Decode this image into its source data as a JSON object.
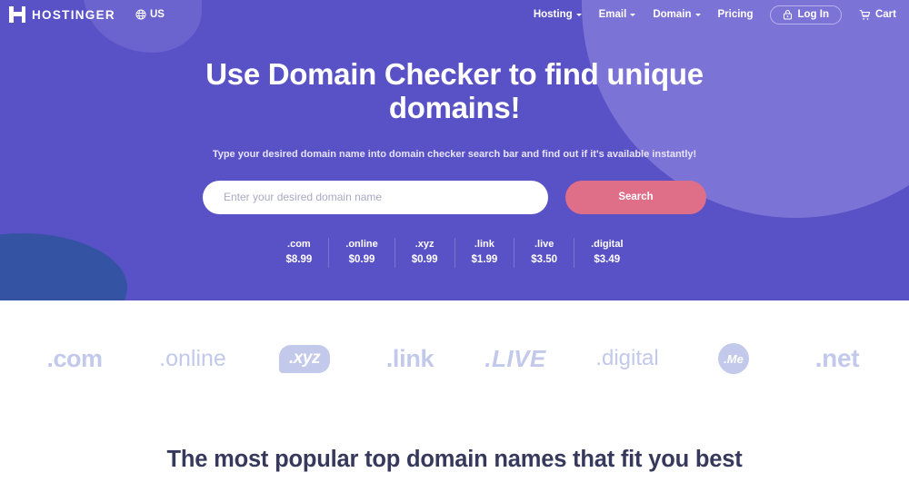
{
  "header": {
    "brand_name": "HOSTINGER",
    "logo_icon": "hostinger-h-logo-icon",
    "locale": {
      "icon": "globe-icon",
      "label": "US"
    },
    "nav": [
      {
        "label": "Hosting",
        "has_caret": true
      },
      {
        "label": "Email",
        "has_caret": true
      },
      {
        "label": "Domain",
        "has_caret": true
      },
      {
        "label": "Pricing",
        "has_caret": false
      }
    ],
    "login": {
      "label": "Log In",
      "icon": "lock-icon"
    },
    "cart": {
      "label": "Cart",
      "icon": "shopping-cart-icon"
    }
  },
  "hero": {
    "title": "Use Domain Checker to find unique domains!",
    "subtitle": "Type your desired domain name into domain checker search bar and find out if it's available instantly!",
    "search": {
      "placeholder": "Enter your desired domain name",
      "value": "",
      "button_label": "Search"
    },
    "prices": [
      {
        "tld": ".com",
        "price": "$8.99"
      },
      {
        "tld": ".online",
        "price": "$0.99"
      },
      {
        "tld": ".xyz",
        "price": "$0.99"
      },
      {
        "tld": ".link",
        "price": "$1.99"
      },
      {
        "tld": ".live",
        "price": "$3.50"
      },
      {
        "tld": ".digital",
        "price": "$3.49"
      }
    ]
  },
  "tld_strip": [
    {
      "label": ".com",
      "style": "plain"
    },
    {
      "label": ".online",
      "style": "plain"
    },
    {
      "label": ".xyz",
      "style": "badge-rounded"
    },
    {
      "label": ".link",
      "style": "plain"
    },
    {
      "label": ".LIVE",
      "style": "italic"
    },
    {
      "label": ".digital",
      "style": "plain"
    },
    {
      "label": ".Me",
      "style": "badge-circle"
    },
    {
      "label": ".net",
      "style": "plain"
    }
  ],
  "bottom": {
    "title": "The most popular top domain names that fit you best"
  },
  "colors": {
    "hero_purple": "#5951c6",
    "blob_light": "#7c73d6",
    "blob_dark": "#2e549c",
    "search_button": "#df6e89",
    "tld_gray_blue": "#c2c9ea",
    "heading_navy": "#36395c"
  }
}
